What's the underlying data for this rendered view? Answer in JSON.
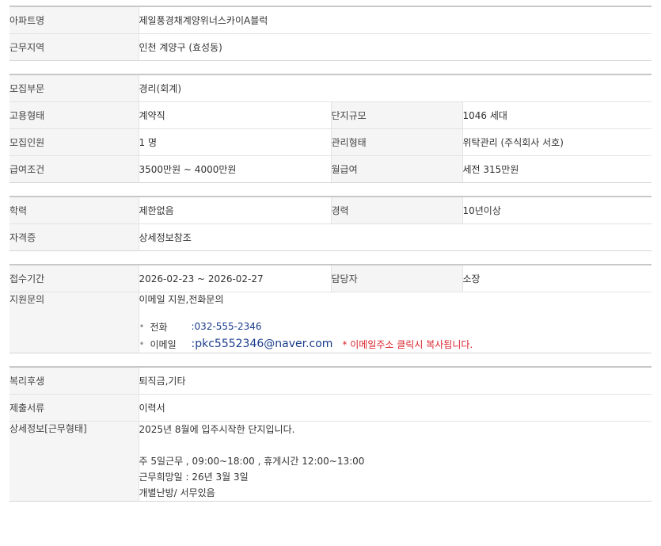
{
  "group1": {
    "apt_label": "아파트명",
    "apt_value": "제일풍경채계양위너스카이A블럭",
    "region_label": "근무지역",
    "region_value": "인천  계양구 (효성동)"
  },
  "group2": {
    "dept_label": "모집부문",
    "dept_value": "경리(회계)",
    "emp_label": "고용형태",
    "emp_value": "계약직",
    "scale_label": "단지규모",
    "scale_value": "1046 세대",
    "count_label": "모집인원",
    "count_value": "1 명",
    "mgmt_label": "관리형태",
    "mgmt_value": "위탁관리 (주식회사 서호)",
    "salary_label": "급여조건",
    "salary_value": "3500만원 ~ 4000만원",
    "monthly_label": "월급여",
    "monthly_value": "세전 315만원"
  },
  "group3": {
    "edu_label": "학력",
    "edu_value": "제한없음",
    "career_label": "경력",
    "career_value": "10년이상",
    "cert_label": "자격증",
    "cert_value": "상세정보참조"
  },
  "group4": {
    "period_label": "접수기간",
    "period_value": "2026-02-23 ~ 2026-02-27",
    "manager_label": "담당자",
    "manager_value": "소장",
    "inquiry_label": "지원문의",
    "inquiry_value": "이메일 지원,전화문의",
    "phone_label": "전화",
    "phone_value": ":032-555-2346",
    "email_label": "이메일",
    "email_value": ":pkc5552346@naver.com",
    "email_note": "* 이메일주소 클릭시 복사됩니다."
  },
  "group5": {
    "welfare_label": "복리후생",
    "welfare_value": "퇴직금,기타",
    "docs_label": "제출서류",
    "docs_value": "이력서",
    "detail_label": "상세정보[근무형태]",
    "detail_lines": [
      "2025년 8월에 입주시작한 단지입니다.",
      "주 5일근무 , 09:00~18:00 , 휴게시간 12:00~13:00",
      "근무희망일 : 26년 3월 3일",
      "개별난방/ 서무있음"
    ]
  }
}
